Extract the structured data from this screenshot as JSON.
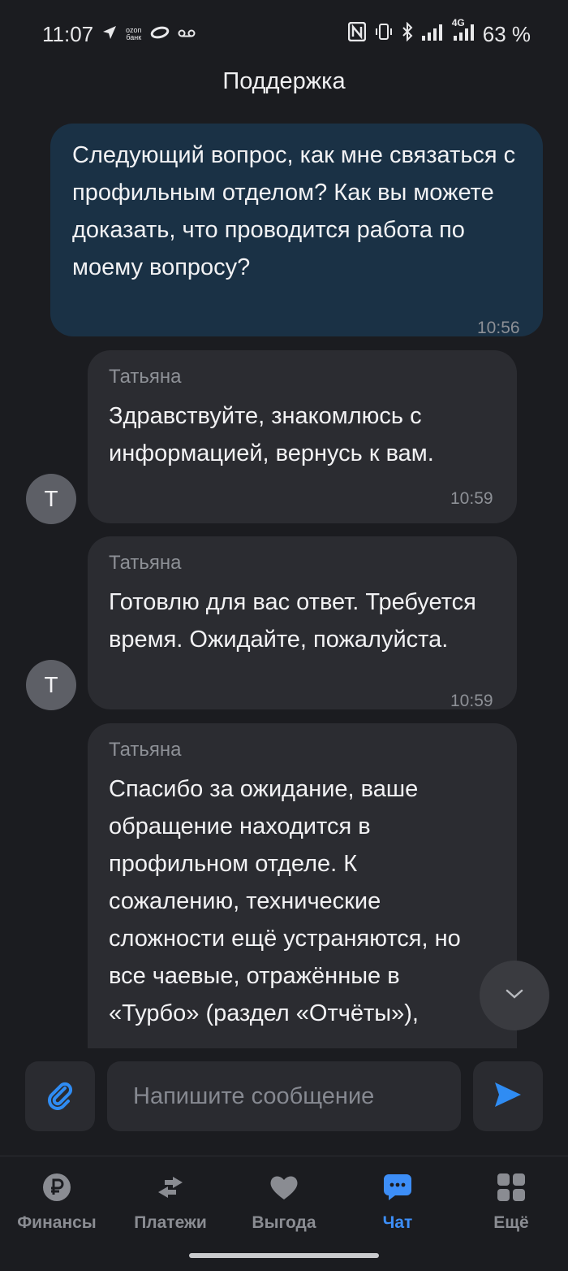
{
  "status_bar": {
    "time": "11:07",
    "ozon_top": "ozon",
    "ozon_bottom": "банк",
    "network": "4G",
    "battery": "63 %",
    "left_icons": [
      "navigation-arrow-icon",
      "ozon-bank-icon",
      "ozon-logo-icon",
      "voicemail-icon"
    ],
    "right_icons": [
      "nfc-icon",
      "vibrate-icon",
      "bluetooth-icon",
      "signal-icon",
      "signal-4g-icon"
    ]
  },
  "header": {
    "title": "Поддержка"
  },
  "messages": [
    {
      "direction": "outgoing",
      "text": "Следующий вопрос, как мне связаться с профильным отделом? Как вы можете доказать, что проводится работа по моему вопросу?",
      "time": "10:56"
    },
    {
      "direction": "incoming",
      "author": "Татьяна",
      "avatar": "Т",
      "text": "Здравствуйте, знакомлюсь с информацией, вернусь к вам.",
      "time": "10:59"
    },
    {
      "direction": "incoming",
      "author": "Татьяна",
      "avatar": "Т",
      "text": "Готовлю для вас ответ. Требуется время. Ожидайте, пожалуйста.",
      "time": "10:59"
    },
    {
      "direction": "incoming",
      "author": "Татьяна",
      "text": "Спасибо за ожидание, ваше обращение находится в профильном отделе. К сожалению, технические сложности ещё устраняются, но все чаевые, отражённые в «Турбо» (раздел «Отчёты»),"
    }
  ],
  "composer": {
    "placeholder": "Напишите сообщение",
    "attach_icon": "paperclip-icon",
    "send_icon": "send-icon",
    "scroll_icon": "chevron-down-icon"
  },
  "nav": {
    "items": [
      {
        "label": "Финансы",
        "icon": "ruble-icon"
      },
      {
        "label": "Платежи",
        "icon": "transfer-arrows-icon"
      },
      {
        "label": "Выгода",
        "icon": "heart-icon"
      },
      {
        "label": "Чат",
        "icon": "chat-bubble-icon",
        "active": true
      },
      {
        "label": "Ещё",
        "icon": "grid-icon"
      }
    ]
  },
  "colors": {
    "accent": "#3d8ef7",
    "background": "#1b1c20",
    "outgoing_bubble": "#1a3145",
    "incoming_bubble": "#2b2c31"
  }
}
